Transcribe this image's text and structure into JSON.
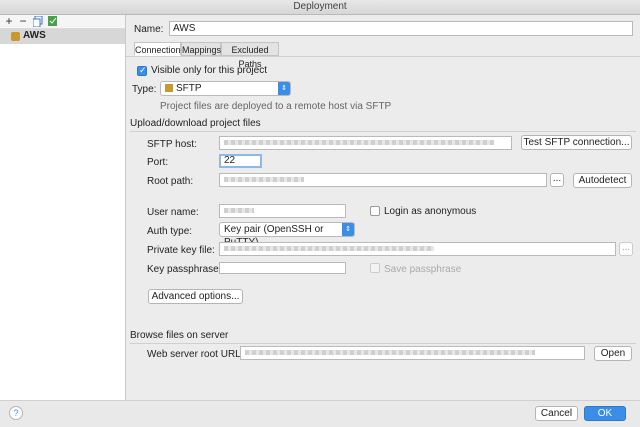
{
  "window": {
    "title": "Deployment"
  },
  "left_panel": {
    "toolbar": {
      "add_label": "+",
      "remove_label": "−"
    },
    "server_name": "AWS"
  },
  "form": {
    "name_label": "Name:",
    "name_value": "AWS",
    "tabs": [
      {
        "label": "Connection"
      },
      {
        "label": "Mappings"
      },
      {
        "label": "Excluded Paths"
      }
    ],
    "visible_only_label": "Visible only for this project",
    "type_label": "Type:",
    "type_value": "SFTP",
    "type_hint": "Project files are deployed to a remote host via SFTP",
    "upload_section": "Upload/download project files",
    "sftp_host_label": "SFTP host:",
    "test_button": "Test SFTP connection...",
    "port_label": "Port:",
    "port_value": "22",
    "root_path_label": "Root path:",
    "ellipsis": "...",
    "autodetect_button": "Autodetect",
    "user_name_label": "User name:",
    "anonymous_label": "Login as anonymous",
    "auth_type_label": "Auth type:",
    "auth_type_value": "Key pair (OpenSSH or PuTTY)",
    "private_key_label": "Private key file:",
    "key_pass_label": "Key passphrase:",
    "save_pass_label": "Save passphrase",
    "advanced_button": "Advanced options...",
    "browse_section": "Browse files on server",
    "web_root_label": "Web server root URL:",
    "open_button": "Open"
  },
  "footer": {
    "help_label": "?",
    "cancel_button": "Cancel",
    "ok_button": "OK"
  },
  "colors": {
    "accent": "#3b8ee8"
  }
}
